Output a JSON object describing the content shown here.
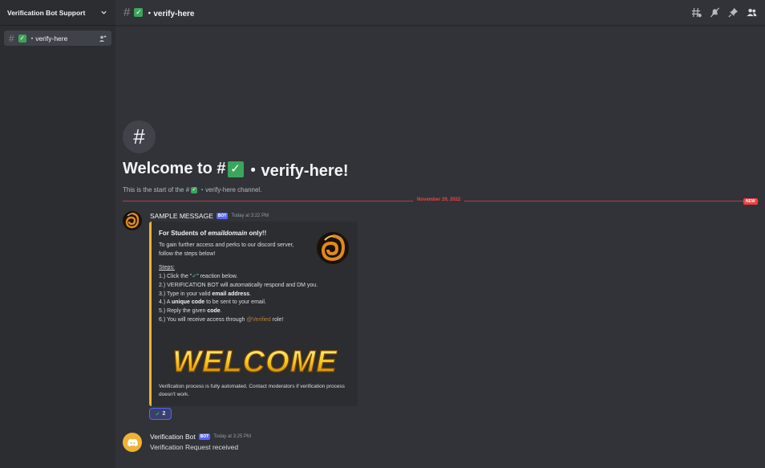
{
  "server": {
    "name": "Verification Bot Support"
  },
  "sidebar": {
    "channels": [
      {
        "label": "・verify-here"
      }
    ]
  },
  "topbar": {
    "channel_name": "・verify-here"
  },
  "welcome": {
    "heading_prefix": "Welcome to #",
    "heading_suffix": "・verify-here!",
    "subtitle_prefix": "This is the start of the #",
    "subtitle_suffix": "・verify-here channel."
  },
  "divider": {
    "date": "November 29, 2022",
    "new_label": "NEW"
  },
  "messages": [
    {
      "author": "SAMPLE MESSAGE",
      "badge": "BOT",
      "time": "Today at 3:22 PM",
      "embed": {
        "title_prefix": "For Students of ",
        "title_emph": "emaildomain",
        "title_suffix": " only!!",
        "description": "To gain further access and perks to our discord server, follow the steps below!",
        "steps_heading": "Steps:",
        "step1_prefix": "1.) Click the \"",
        "step1_suffix": "\" reaction below.",
        "step2": "2.) VERIFICATION BOT will automatically respond and DM you.",
        "step3_prefix": "3.) Type in your valid ",
        "step3_bold": "email address",
        "step3_suffix": ".",
        "step4_prefix": "4.) A ",
        "step4_bold": "unique code",
        "step4_suffix": " to be sent to your email.",
        "step5_prefix": "5.) Reply the given ",
        "step5_bold": "code",
        "step5_suffix": ".",
        "step6_prefix": "6.) You will receive access through ",
        "step6_mention": "@Verified",
        "step6_suffix": " role!",
        "image_text": "WELCOME",
        "footer": "Verification process is fully automated.  Contact moderators if verification process doesn't work."
      },
      "reaction": {
        "emoji": "check-mark",
        "count": "2"
      }
    },
    {
      "author": "Verification Bot",
      "badge": "BOT",
      "time": "Today at 3:25 PM",
      "content": "Verification Request received"
    }
  ],
  "colors": {
    "accent": "#5865f2",
    "embed_border": "#f0b232",
    "new_red": "#f23f42",
    "check_green": "#3ba55c",
    "mention": "#c27c32"
  }
}
